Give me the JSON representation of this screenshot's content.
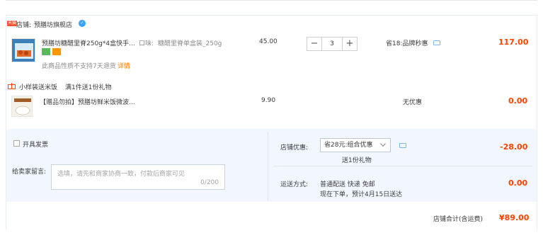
{
  "colors": {
    "accent_red": "#ff4400",
    "link_orange": "#ff7b00",
    "panel_bg": "#f2f7ff"
  },
  "shop": {
    "badge": "天猫",
    "label": "店铺:",
    "name": "预膳坊旗舰店"
  },
  "item": {
    "title": "预膳坊糖醋里脊250g*4盒快手...",
    "attr_label": "口味:",
    "attr_value": "糖醋里脊单盒装_250g",
    "unit_price": "45.00",
    "quantity": "3",
    "discount": "省18:品牌秒惠",
    "subtotal": "117.00",
    "return_note": "此商品性质不支持7天退货",
    "return_link": "详情"
  },
  "promo": {
    "name": "小样装送米饭",
    "rule": "满1件送1份礼物"
  },
  "gift": {
    "title": "【赠品勿拍】预膳坊鲜米饭微波...",
    "price": "9.90",
    "discount": "无优惠",
    "subtotal": "0.00"
  },
  "invoice": {
    "label": "开具发票"
  },
  "message": {
    "label": "给卖家留言:",
    "placeholder": "选填，请先和商家协商一致，付款后商家可见",
    "counter": "0/200"
  },
  "shop_discount": {
    "label": "店铺优惠:",
    "selected": "省28元:组合优惠",
    "gift_note": "送1份礼物",
    "amount": "-28.00"
  },
  "delivery": {
    "label": "运送方式:",
    "method": "普通配送 快递 免邮",
    "eta": "现在下单，预计4月15日送达",
    "fee": "0.00"
  },
  "total": {
    "label": "店铺合计(含运费)",
    "amount": "¥89.00"
  }
}
